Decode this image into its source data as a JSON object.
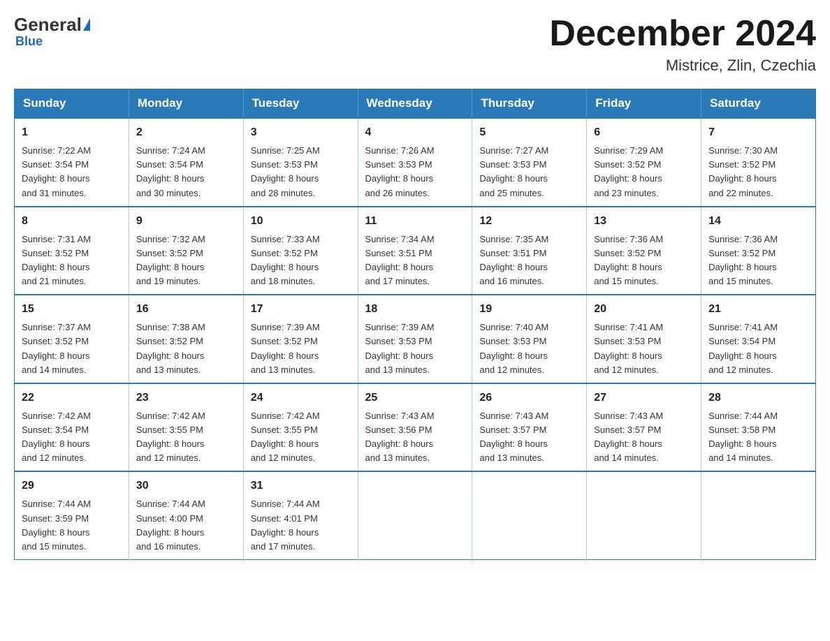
{
  "logo": {
    "general": "General",
    "blue": "Blue",
    "subtitle": "Blue"
  },
  "title": "December 2024",
  "location": "Mistrice, Zlin, Czechia",
  "days_header": [
    "Sunday",
    "Monday",
    "Tuesday",
    "Wednesday",
    "Thursday",
    "Friday",
    "Saturday"
  ],
  "weeks": [
    [
      {
        "day": "1",
        "sunrise": "7:22 AM",
        "sunset": "3:54 PM",
        "daylight": "8 hours and 31 minutes."
      },
      {
        "day": "2",
        "sunrise": "7:24 AM",
        "sunset": "3:54 PM",
        "daylight": "8 hours and 30 minutes."
      },
      {
        "day": "3",
        "sunrise": "7:25 AM",
        "sunset": "3:53 PM",
        "daylight": "8 hours and 28 minutes."
      },
      {
        "day": "4",
        "sunrise": "7:26 AM",
        "sunset": "3:53 PM",
        "daylight": "8 hours and 26 minutes."
      },
      {
        "day": "5",
        "sunrise": "7:27 AM",
        "sunset": "3:53 PM",
        "daylight": "8 hours and 25 minutes."
      },
      {
        "day": "6",
        "sunrise": "7:29 AM",
        "sunset": "3:52 PM",
        "daylight": "8 hours and 23 minutes."
      },
      {
        "day": "7",
        "sunrise": "7:30 AM",
        "sunset": "3:52 PM",
        "daylight": "8 hours and 22 minutes."
      }
    ],
    [
      {
        "day": "8",
        "sunrise": "7:31 AM",
        "sunset": "3:52 PM",
        "daylight": "8 hours and 21 minutes."
      },
      {
        "day": "9",
        "sunrise": "7:32 AM",
        "sunset": "3:52 PM",
        "daylight": "8 hours and 19 minutes."
      },
      {
        "day": "10",
        "sunrise": "7:33 AM",
        "sunset": "3:52 PM",
        "daylight": "8 hours and 18 minutes."
      },
      {
        "day": "11",
        "sunrise": "7:34 AM",
        "sunset": "3:51 PM",
        "daylight": "8 hours and 17 minutes."
      },
      {
        "day": "12",
        "sunrise": "7:35 AM",
        "sunset": "3:51 PM",
        "daylight": "8 hours and 16 minutes."
      },
      {
        "day": "13",
        "sunrise": "7:36 AM",
        "sunset": "3:52 PM",
        "daylight": "8 hours and 15 minutes."
      },
      {
        "day": "14",
        "sunrise": "7:36 AM",
        "sunset": "3:52 PM",
        "daylight": "8 hours and 15 minutes."
      }
    ],
    [
      {
        "day": "15",
        "sunrise": "7:37 AM",
        "sunset": "3:52 PM",
        "daylight": "8 hours and 14 minutes."
      },
      {
        "day": "16",
        "sunrise": "7:38 AM",
        "sunset": "3:52 PM",
        "daylight": "8 hours and 13 minutes."
      },
      {
        "day": "17",
        "sunrise": "7:39 AM",
        "sunset": "3:52 PM",
        "daylight": "8 hours and 13 minutes."
      },
      {
        "day": "18",
        "sunrise": "7:39 AM",
        "sunset": "3:53 PM",
        "daylight": "8 hours and 13 minutes."
      },
      {
        "day": "19",
        "sunrise": "7:40 AM",
        "sunset": "3:53 PM",
        "daylight": "8 hours and 12 minutes."
      },
      {
        "day": "20",
        "sunrise": "7:41 AM",
        "sunset": "3:53 PM",
        "daylight": "8 hours and 12 minutes."
      },
      {
        "day": "21",
        "sunrise": "7:41 AM",
        "sunset": "3:54 PM",
        "daylight": "8 hours and 12 minutes."
      }
    ],
    [
      {
        "day": "22",
        "sunrise": "7:42 AM",
        "sunset": "3:54 PM",
        "daylight": "8 hours and 12 minutes."
      },
      {
        "day": "23",
        "sunrise": "7:42 AM",
        "sunset": "3:55 PM",
        "daylight": "8 hours and 12 minutes."
      },
      {
        "day": "24",
        "sunrise": "7:42 AM",
        "sunset": "3:55 PM",
        "daylight": "8 hours and 12 minutes."
      },
      {
        "day": "25",
        "sunrise": "7:43 AM",
        "sunset": "3:56 PM",
        "daylight": "8 hours and 13 minutes."
      },
      {
        "day": "26",
        "sunrise": "7:43 AM",
        "sunset": "3:57 PM",
        "daylight": "8 hours and 13 minutes."
      },
      {
        "day": "27",
        "sunrise": "7:43 AM",
        "sunset": "3:57 PM",
        "daylight": "8 hours and 14 minutes."
      },
      {
        "day": "28",
        "sunrise": "7:44 AM",
        "sunset": "3:58 PM",
        "daylight": "8 hours and 14 minutes."
      }
    ],
    [
      {
        "day": "29",
        "sunrise": "7:44 AM",
        "sunset": "3:59 PM",
        "daylight": "8 hours and 15 minutes."
      },
      {
        "day": "30",
        "sunrise": "7:44 AM",
        "sunset": "4:00 PM",
        "daylight": "8 hours and 16 minutes."
      },
      {
        "day": "31",
        "sunrise": "7:44 AM",
        "sunset": "4:01 PM",
        "daylight": "8 hours and 17 minutes."
      },
      null,
      null,
      null,
      null
    ]
  ],
  "labels": {
    "sunrise": "Sunrise:",
    "sunset": "Sunset:",
    "daylight": "Daylight:"
  }
}
